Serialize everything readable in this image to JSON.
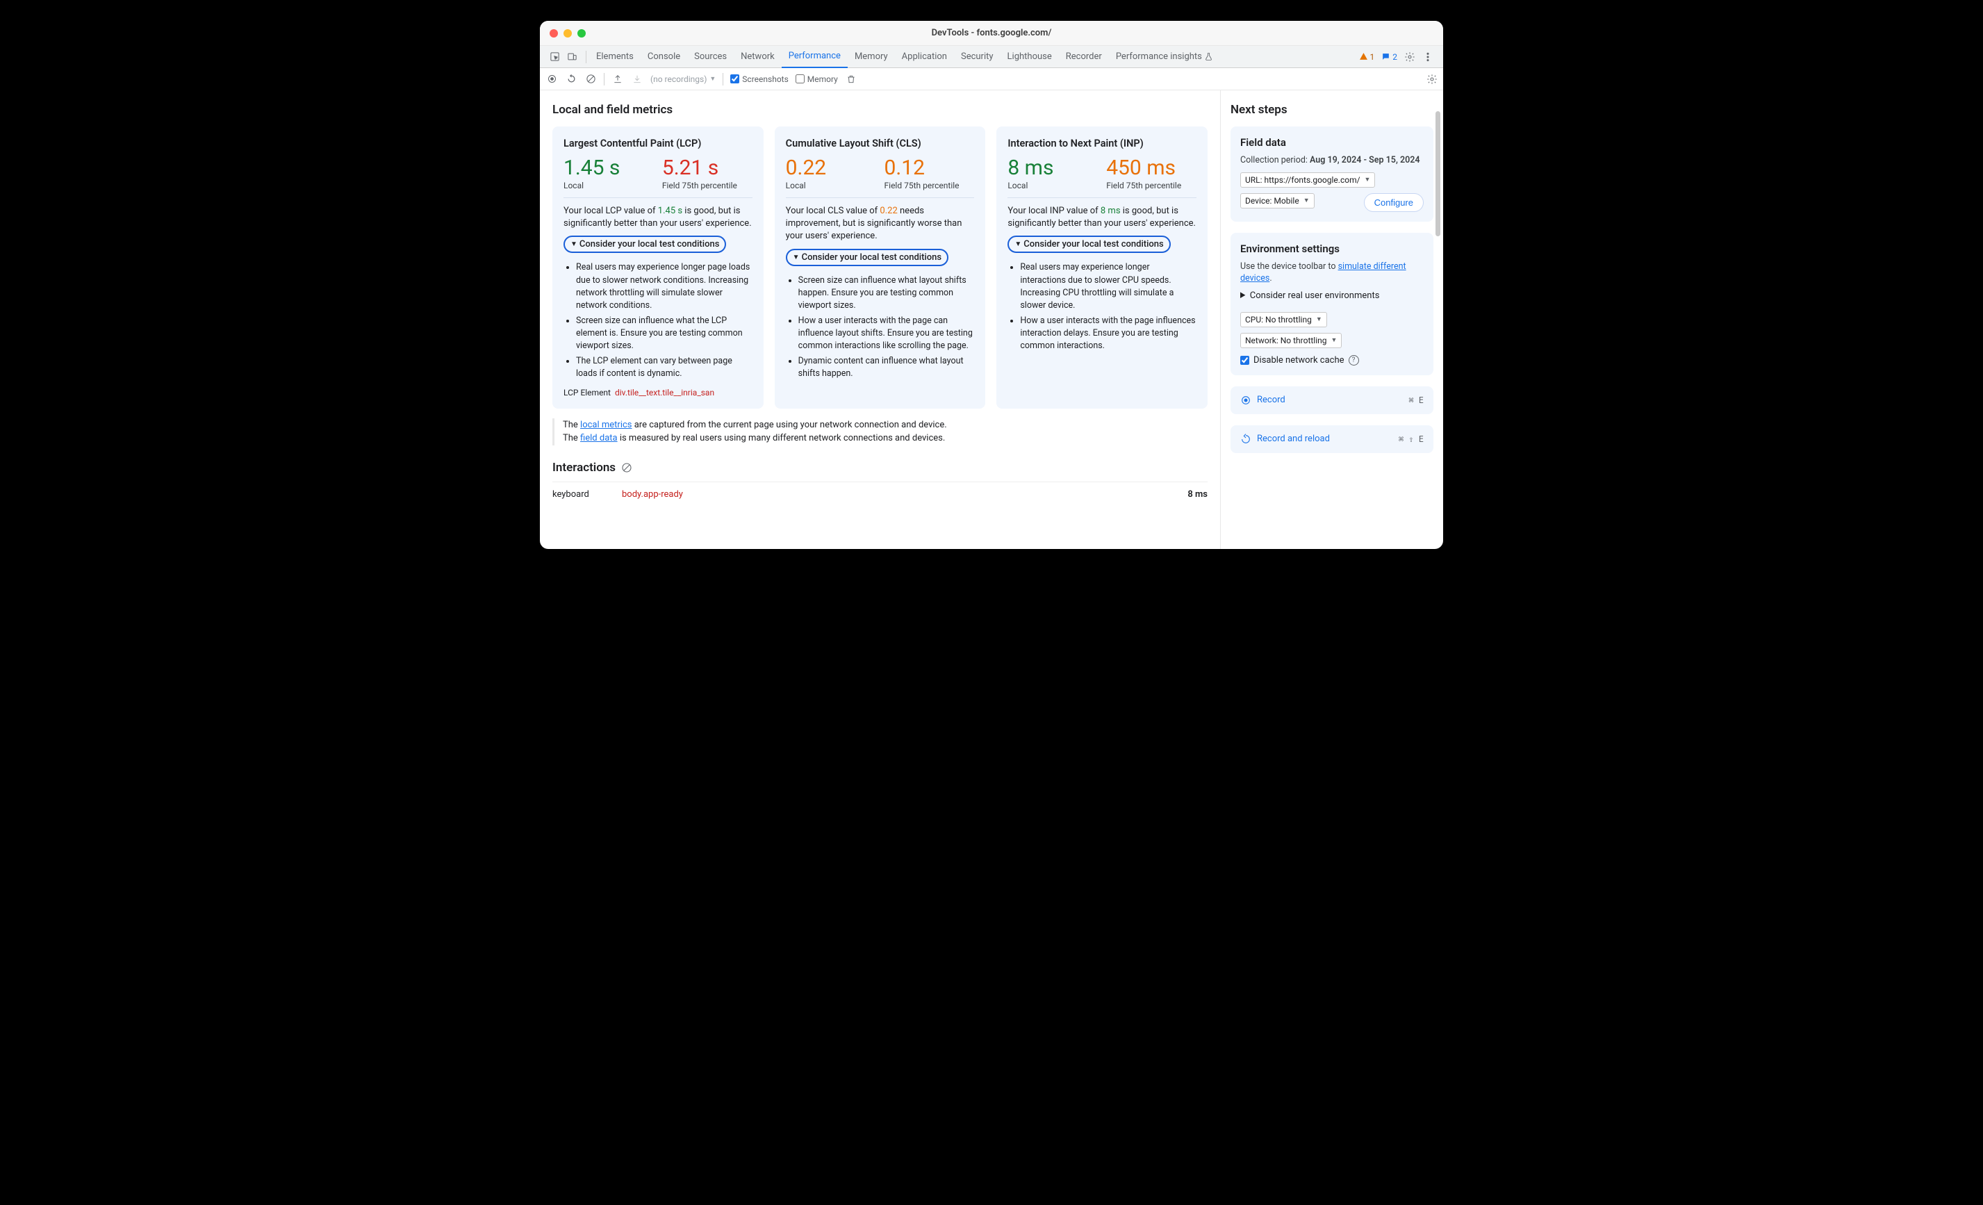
{
  "title": "DevTools - fonts.google.com/",
  "tabs": [
    "Elements",
    "Console",
    "Sources",
    "Network",
    "Performance",
    "Memory",
    "Application",
    "Security",
    "Lighthouse",
    "Recorder",
    "Performance insights"
  ],
  "activeTab": "Performance",
  "warnCount": "1",
  "msgCount": "2",
  "toolbar": {
    "recordings": "(no recordings)",
    "screenshots": "Screenshots",
    "memory": "Memory"
  },
  "main": {
    "heading": "Local and field metrics",
    "cards": {
      "lcp": {
        "title": "Largest Contentful Paint (LCP)",
        "local_val": "1.45 s",
        "local_label": "Local",
        "field_val": "5.21 s",
        "field_label": "Field 75th percentile",
        "desc_pre": "Your local LCP value of ",
        "desc_hl": "1.45 s",
        "desc_post": " is good, but is significantly better than your users' experience.",
        "summary": "Consider your local test conditions",
        "bullets": [
          "Real users may experience longer page loads due to slower network conditions. Increasing network throttling will simulate slower network conditions.",
          "Screen size can influence what the LCP element is. Ensure you are testing common viewport sizes.",
          "The LCP element can vary between page loads if content is dynamic."
        ],
        "lcp_el_label": "LCP Element",
        "lcp_el_sel": "div.tile__text.tile__inria_san"
      },
      "cls": {
        "title": "Cumulative Layout Shift (CLS)",
        "local_val": "0.22",
        "local_label": "Local",
        "field_val": "0.12",
        "field_label": "Field 75th percentile",
        "desc_pre": "Your local CLS value of ",
        "desc_hl": "0.22",
        "desc_post": " needs improvement, but is significantly worse than your users' experience.",
        "summary": "Consider your local test conditions",
        "bullets": [
          "Screen size can influence what layout shifts happen. Ensure you are testing common viewport sizes.",
          "How a user interacts with the page can influence layout shifts. Ensure you are testing common interactions like scrolling the page.",
          "Dynamic content can influence what layout shifts happen."
        ]
      },
      "inp": {
        "title": "Interaction to Next Paint (INP)",
        "local_val": "8 ms",
        "local_label": "Local",
        "field_val": "450 ms",
        "field_label": "Field 75th percentile",
        "desc_pre": "Your local INP value of ",
        "desc_hl": "8 ms",
        "desc_post": " is good, but is significantly better than your users' experience.",
        "summary": "Consider your local test conditions",
        "bullets": [
          "Real users may experience longer interactions due to slower CPU speeds. Increasing CPU throttling will simulate a slower device.",
          "How a user interacts with the page influences interaction delays. Ensure you are testing common interactions."
        ]
      }
    },
    "footnote_1a": "The ",
    "footnote_1link": "local metrics",
    "footnote_1b": " are captured from the current page using your network connection and device.",
    "footnote_2a": "The ",
    "footnote_2link": "field data",
    "footnote_2b": " is measured by real users using many different network connections and devices.",
    "interactions_heading": "Interactions",
    "interaction_row": {
      "kind": "keyboard",
      "selector": "body.app-ready",
      "time": "8 ms"
    }
  },
  "side": {
    "next_steps": "Next steps",
    "field": {
      "title": "Field data",
      "period_label": "Collection period: ",
      "period_value": "Aug 19, 2024 - Sep 15, 2024",
      "url": "URL: https://fonts.google.com/",
      "device": "Device: Mobile",
      "configure": "Configure"
    },
    "env": {
      "title": "Environment settings",
      "text_a": "Use the device toolbar to ",
      "text_link": "simulate different devices",
      "text_b": ".",
      "details": "Consider real user environments",
      "cpu": "CPU: No throttling",
      "network": "Network: No throttling",
      "cache": "Disable network cache"
    },
    "record": {
      "label": "Record",
      "kbd": "⌘ E"
    },
    "record_reload": {
      "label": "Record and reload",
      "kbd": "⌘ ⇧ E"
    }
  }
}
